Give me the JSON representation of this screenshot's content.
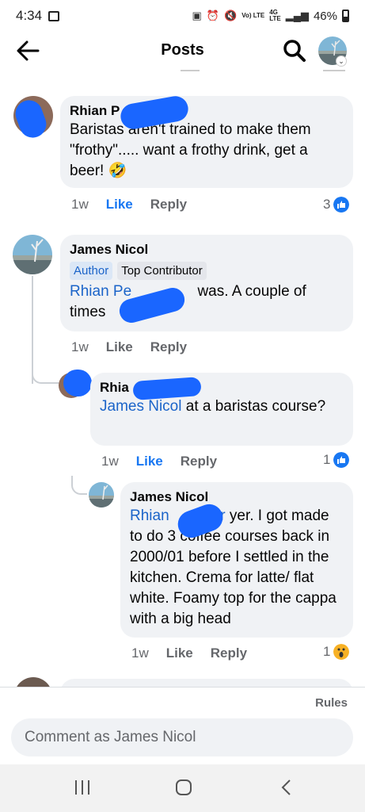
{
  "status_bar": {
    "time": "4:34",
    "battery": "46%",
    "network": "4G",
    "lte": "LTE",
    "volte": "Vo) LTE"
  },
  "header": {
    "title": "Posts"
  },
  "comments": [
    {
      "name": "Rhian P",
      "text": "Baristas aren't trained to make them \"frothy\"..... want a frothy drink, get a beer! 🤣",
      "time": "1w",
      "like": "Like",
      "reply": "Reply",
      "reaction_count": "3",
      "reaction": "like-icon"
    },
    {
      "name": "James Nicol",
      "badges": [
        "Author",
        "Top Contributor"
      ],
      "mention": "Rhian Pe",
      "text": "was. A couple of times",
      "time": "1w",
      "like": "Like",
      "reply": "Reply"
    },
    {
      "name": "Rhia",
      "mention": "James Nicol",
      "text": "at a baristas course?",
      "time": "1w",
      "like": "Like",
      "reply": "Reply",
      "reaction_count": "1",
      "reaction": "like-icon"
    },
    {
      "name": "James Nicol",
      "mention": "Rhian",
      "mention_tail": "tzer",
      "text": "yer. I got made to do 3 coffee courses back in 2000/01 before I settled in the kitchen. Crema for latte/ flat white. Foamy top for the cappa with a big head",
      "time": "1w",
      "like": "Like",
      "reply": "Reply",
      "reaction_count": "1",
      "reaction": "wow-icon"
    }
  ],
  "footer": {
    "rules": "Rules",
    "comment_placeholder": "Comment as James Nicol"
  },
  "colors": {
    "accent": "#1877f2",
    "bubble": "#f0f2f5",
    "redaction": "#1a66ff",
    "muted": "#65676b"
  }
}
